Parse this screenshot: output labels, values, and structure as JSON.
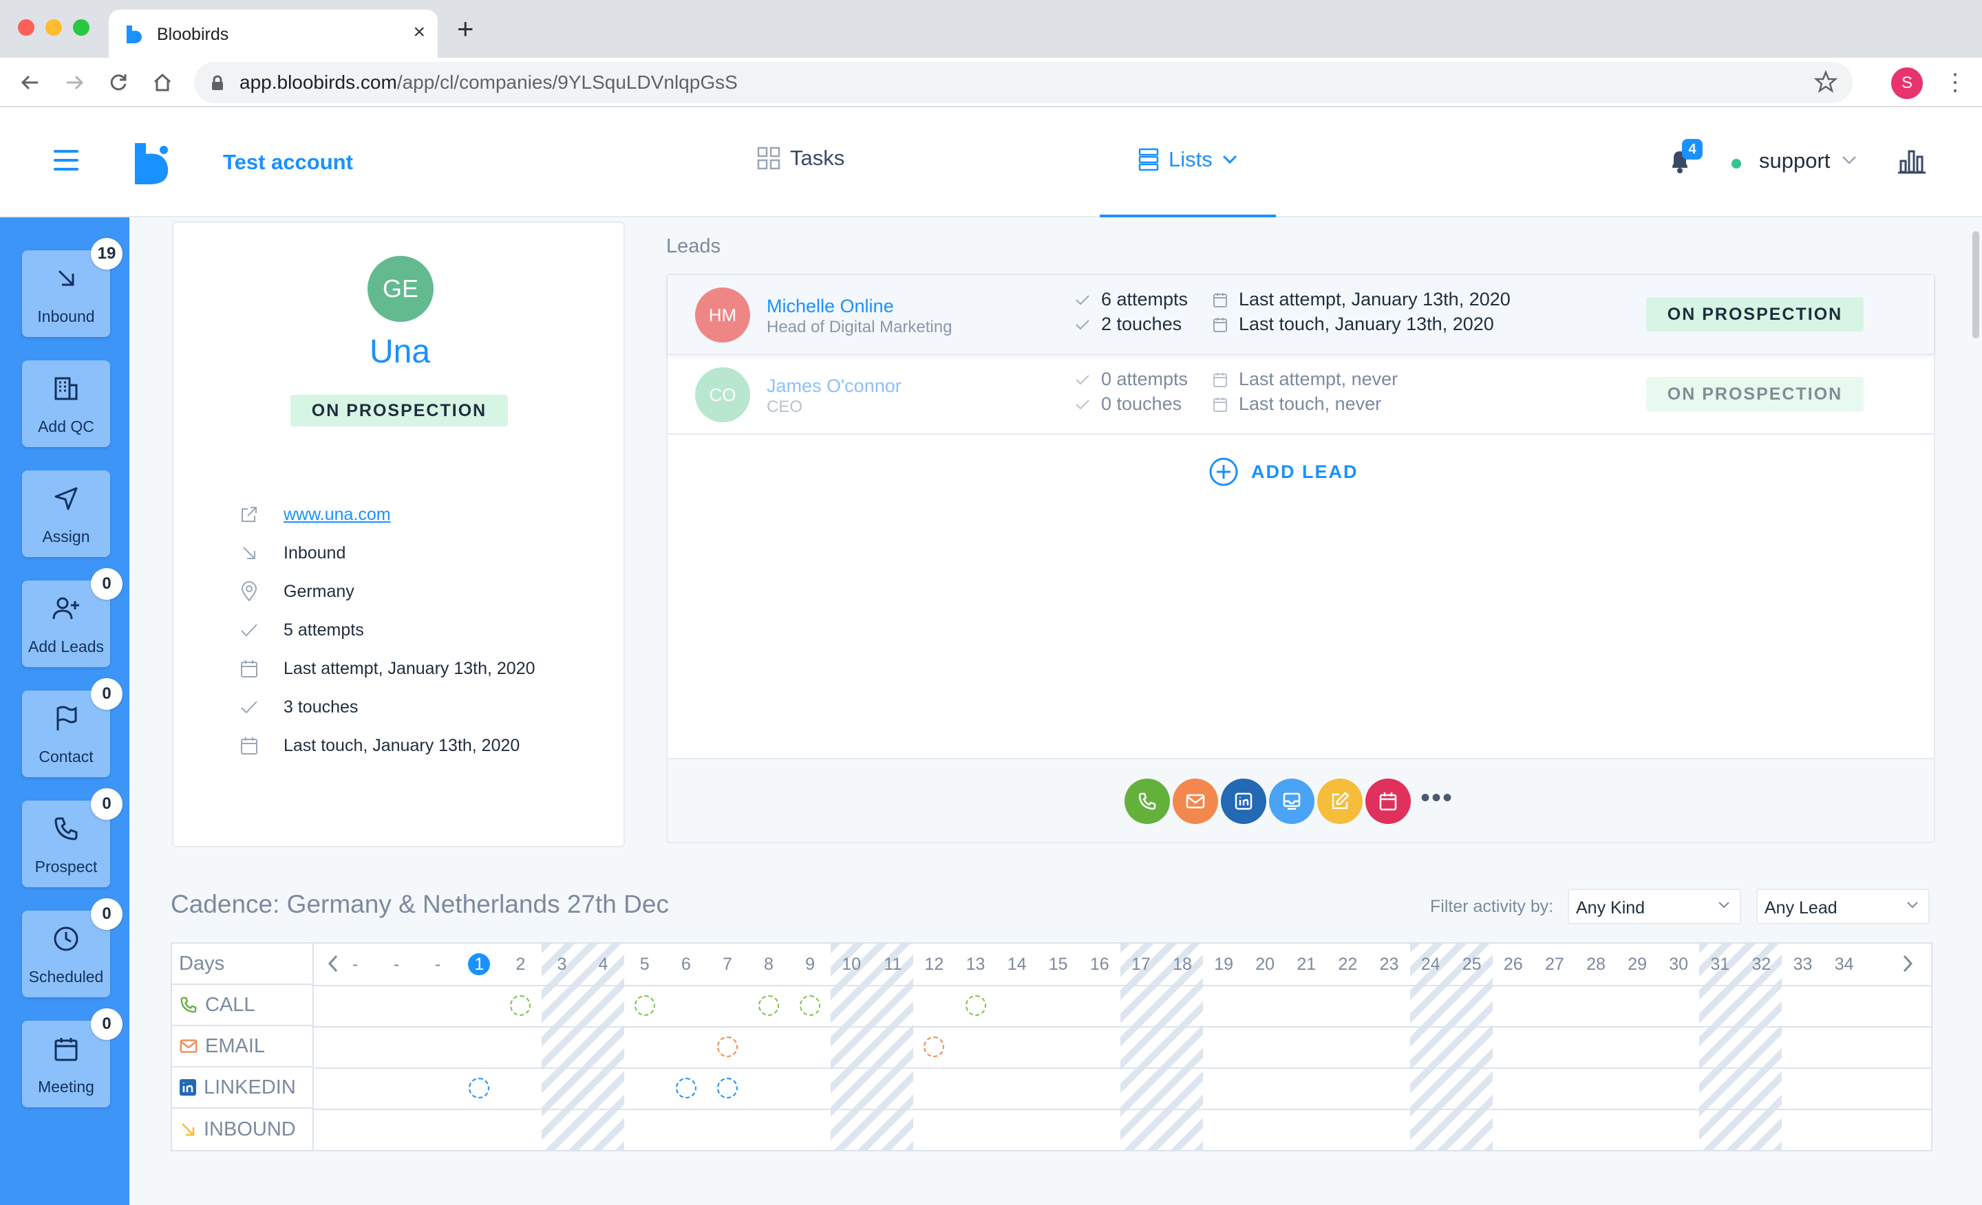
{
  "browser": {
    "tab_title": "Bloobirds",
    "tab_close": "×",
    "new_tab": "+",
    "url_domain": "app.bloobirds.com",
    "url_path": "/app/cl/companies/9YLSquLDVnlqpGsS",
    "profile_initial": "S"
  },
  "header": {
    "account_name": "Test account",
    "nav_tasks": "Tasks",
    "nav_lists": "Lists",
    "notifications_count": "4",
    "user_name": "support"
  },
  "sidebar": {
    "items": [
      {
        "label": "Inbound",
        "icon": "arrow-down-right-icon",
        "badge": "19"
      },
      {
        "label": "Add QC",
        "icon": "building-icon",
        "badge": ""
      },
      {
        "label": "Assign",
        "icon": "send-icon",
        "badge": ""
      },
      {
        "label": "Add Leads",
        "icon": "user-plus-icon",
        "badge": "0"
      },
      {
        "label": "Contact",
        "icon": "flag-icon",
        "badge": "0"
      },
      {
        "label": "Prospect",
        "icon": "phone-icon",
        "badge": "0"
      },
      {
        "label": "Scheduled",
        "icon": "clock-icon",
        "badge": "0"
      },
      {
        "label": "Meeting",
        "icon": "calendar-icon",
        "badge": "0"
      }
    ]
  },
  "company": {
    "initials": "GE",
    "name": "Una",
    "status": "ON PROSPECTION",
    "website": "www.una.com",
    "source": "Inbound",
    "country": "Germany",
    "attempts": "5 attempts",
    "last_attempt": "Last attempt, January 13th, 2020",
    "touches": "3 touches",
    "last_touch": "Last touch, January 13th, 2020"
  },
  "leads": {
    "title": "Leads",
    "rows": [
      {
        "initials": "HM",
        "name": "Michelle Online",
        "role": "Head of Digital Marketing",
        "attempts": "6 attempts",
        "touches": "2 touches",
        "last_attempt": "Last attempt, January 13th, 2020",
        "last_touch": "Last touch, January 13th, 2020",
        "status": "ON PROSPECTION",
        "avatar_color": "#ef8686"
      },
      {
        "initials": "CO",
        "name": "James O'connor",
        "role": "CEO",
        "attempts": "0 attempts",
        "touches": "0 touches",
        "last_attempt": "Last attempt, never",
        "last_touch": "Last touch, never",
        "status": "ON PROSPECTION",
        "avatar_color": "#7fd3a8"
      }
    ],
    "add_lead_label": "ADD LEAD",
    "more_label": "•••",
    "action_colors": {
      "call": "#63b13b",
      "email": "#f3884e",
      "linkedin": "#2369b3",
      "inbox": "#4aa3f5",
      "note": "#f6bd3a",
      "meeting": "#e0305c"
    }
  },
  "cadence": {
    "title": "Cadence: Germany & Netherlands 27th Dec",
    "filter_label": "Filter activity by:",
    "filter_kind": "Any Kind",
    "filter_lead": "Any Lead",
    "days_header": "Days",
    "days": [
      "-",
      "-",
      "-",
      "1",
      "2",
      "3",
      "4",
      "5",
      "6",
      "7",
      "8",
      "9",
      "10",
      "11",
      "12",
      "13",
      "14",
      "15",
      "16",
      "17",
      "18",
      "19",
      "20",
      "21",
      "22",
      "23",
      "24",
      "25",
      "26",
      "27",
      "28",
      "29",
      "30",
      "31",
      "32",
      "33",
      "34"
    ],
    "today": "1",
    "weekend_days": [
      "3",
      "4",
      "10",
      "11",
      "17",
      "18",
      "24",
      "25",
      "31",
      "32"
    ],
    "rows": [
      {
        "label": "CALL",
        "type": "call",
        "days": [
          "2",
          "5",
          "8",
          "9",
          "13"
        ]
      },
      {
        "label": "EMAIL",
        "type": "email",
        "days": [
          "7",
          "12"
        ]
      },
      {
        "label": "LINKEDIN",
        "type": "linkedin",
        "days": [
          "1",
          "6",
          "7"
        ]
      },
      {
        "label": "INBOUND",
        "type": "inbound",
        "days": []
      }
    ]
  }
}
